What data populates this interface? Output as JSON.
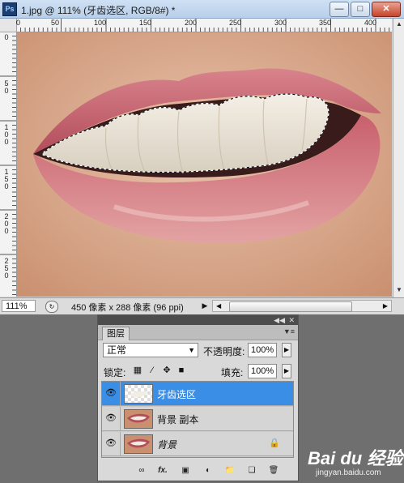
{
  "window": {
    "app_icon": "Ps",
    "title": "1.jpg @ 111% (牙齿选区, RGB/8#) *",
    "controls": [
      "minimize",
      "restore",
      "close"
    ]
  },
  "rulers": {
    "top": [
      "0",
      "50",
      "100",
      "150",
      "200",
      "250",
      "300",
      "350",
      "400"
    ],
    "left": [
      "0",
      "50",
      "100",
      "150",
      "200",
      "250"
    ]
  },
  "status": {
    "zoom": "111%",
    "doc_info": "450 像素 x 288 像素 (96 ppi)"
  },
  "layers_panel": {
    "tab": "图层",
    "blend_mode": "正常",
    "opacity_label": "不透明度:",
    "opacity_value": "100%",
    "lock_label": "锁定:",
    "fill_label": "填充:",
    "fill_value": "100%",
    "layers": [
      {
        "name": "牙齿选区",
        "selected": true,
        "visible": true,
        "locked": false
      },
      {
        "name": "背景 副本",
        "selected": false,
        "visible": true,
        "locked": false
      },
      {
        "name": "背景",
        "selected": false,
        "visible": true,
        "locked": true
      }
    ],
    "bottom_icons": [
      "link-icon",
      "fx-icon",
      "mask-icon",
      "adjustment-icon",
      "group-icon",
      "new-layer-icon",
      "trash-icon"
    ],
    "fx_label": "fx."
  },
  "watermark": {
    "text": "Bai du 经验",
    "url": "jingyan.baidu.com"
  },
  "colors": {
    "selection": "#3a8ee6",
    "panel_bg": "#d9d9d9",
    "lip": "#c85a6a",
    "skin": "#e2b59a"
  }
}
